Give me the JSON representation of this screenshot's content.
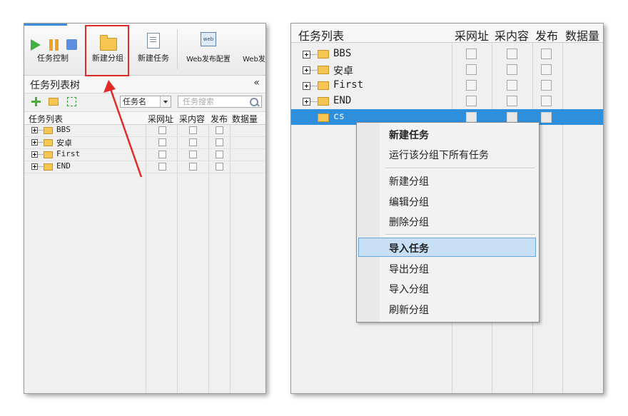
{
  "left": {
    "toolbar": {
      "task_control_label": "任务控制",
      "new_group_label": "新建分组",
      "new_task_label": "新建任务",
      "web_publish_config_label": "Web发布配置",
      "web_publish_partial_label": "Web发"
    },
    "tree": {
      "title": "任务列表树",
      "collapse_glyph": "«",
      "filter_select_value": "任务名",
      "search_placeholder": "任务搜索"
    },
    "columns": [
      "任务列表",
      "采网址",
      "采内容",
      "发布",
      "数据量"
    ],
    "rows": [
      "BBS",
      "安卓",
      "First",
      "END"
    ]
  },
  "right": {
    "columns": [
      "任务列表",
      "采网址",
      "采内容",
      "发布",
      "数据量"
    ],
    "rows": [
      "BBS",
      "安卓",
      "First",
      "END",
      "cs"
    ],
    "selected_row": "cs",
    "context_menu": {
      "items": [
        "新建任务",
        "运行该分组下所有任务",
        "新建分组",
        "编辑分组",
        "删除分组",
        "导入任务",
        "导出分组",
        "导入分组",
        "刷新分组"
      ],
      "highlighted": "导入任务"
    }
  },
  "colors": {
    "selection": "#2e8fdc",
    "highlight_border": "#e02a2a",
    "menu_highlight": "#c7e0f6"
  }
}
